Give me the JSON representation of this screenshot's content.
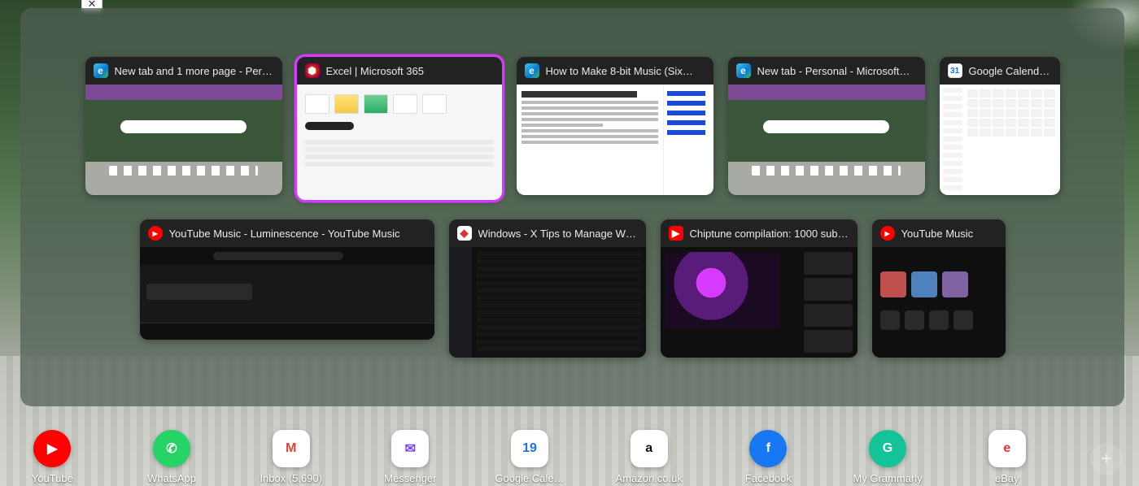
{
  "close_x": "✕",
  "switcher": {
    "row1": [
      {
        "title": "New tab and 1 more page - Per…",
        "icon": "edge"
      },
      {
        "title": "Excel | Microsoft 365",
        "icon": "m365",
        "selected": true
      },
      {
        "title": "How to Make 8-bit Music (Six…",
        "icon": "edge"
      },
      {
        "title": "New tab - Personal - Microsoft…",
        "icon": "edge"
      },
      {
        "title": "Google Calend…",
        "icon": "gcal"
      }
    ],
    "row2": [
      {
        "title": "YouTube Music - Luminescence - YouTube Music",
        "icon": "ytm"
      },
      {
        "title": "Windows - X Tips to Manage W…",
        "icon": "win"
      },
      {
        "title": "Chiptune compilation: 1000 sub…",
        "icon": "yt"
      },
      {
        "title": "YouTube Music",
        "icon": "ytm"
      }
    ]
  },
  "gcal_day": "31",
  "shortcuts": [
    {
      "label": "YouTube",
      "glyph": "▶",
      "bg": "#ff0000",
      "fg": "#ffffff",
      "round": true
    },
    {
      "label": "WhatsApp",
      "glyph": "✆",
      "bg": "#25d366",
      "fg": "#ffffff",
      "round": true
    },
    {
      "label": "Inbox (5,690)",
      "glyph": "M",
      "bg": "#ffffff",
      "fg": "#ea4335"
    },
    {
      "label": "Messenger",
      "glyph": "✉",
      "bg": "#ffffff",
      "fg": "#7b3ff2"
    },
    {
      "label": "Google Cale…",
      "glyph": "19",
      "bg": "#ffffff",
      "fg": "#1a73e8"
    },
    {
      "label": "Amazon.co.uk",
      "glyph": "a",
      "bg": "#ffffff",
      "fg": "#111111"
    },
    {
      "label": "Facebook",
      "glyph": "f",
      "bg": "#1877f2",
      "fg": "#ffffff",
      "round": true
    },
    {
      "label": "My Grammarly",
      "glyph": "G",
      "bg": "#15c39a",
      "fg": "#ffffff",
      "round": true
    },
    {
      "label": "eBay",
      "glyph": "e",
      "bg": "#ffffff",
      "fg": "#e53238"
    }
  ],
  "add_glyph": "+"
}
